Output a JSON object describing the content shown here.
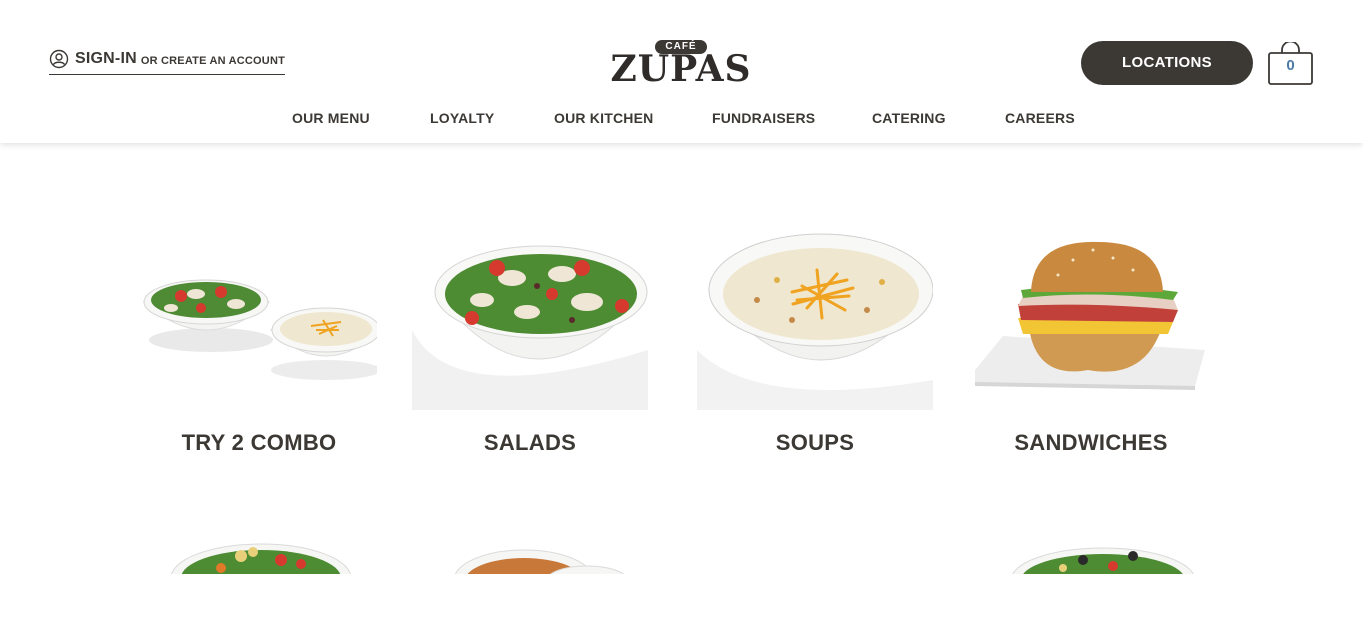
{
  "header": {
    "sign_in_label": "SIGN-IN",
    "create_account_label": "OR CREATE AN ACCOUNT",
    "logo_badge": "CAFÉ",
    "logo_word": "ZUPAS",
    "locations_label": "LOCATIONS",
    "cart_count": "0"
  },
  "nav": {
    "items": [
      {
        "label": "OUR MENU"
      },
      {
        "label": "LOYALTY"
      },
      {
        "label": "OUR KITCHEN"
      },
      {
        "label": "FUNDRAISERS"
      },
      {
        "label": "CATERING"
      },
      {
        "label": "CAREERS"
      }
    ]
  },
  "menu": {
    "categories": [
      {
        "title": "TRY 2 COMBO",
        "icon": "combo-salad-soup-image"
      },
      {
        "title": "SALADS",
        "icon": "salad-bowl-image"
      },
      {
        "title": "SOUPS",
        "icon": "soup-bowl-image"
      },
      {
        "title": "SANDWICHES",
        "icon": "sandwich-image"
      }
    ],
    "row2_icons": [
      "bowl-image",
      "soup-image",
      "empty",
      "pasta-bowl-image"
    ]
  },
  "colors": {
    "primary_dark": "#3c3935",
    "cart_count": "#4d7ba8",
    "background": "#ffffff"
  }
}
